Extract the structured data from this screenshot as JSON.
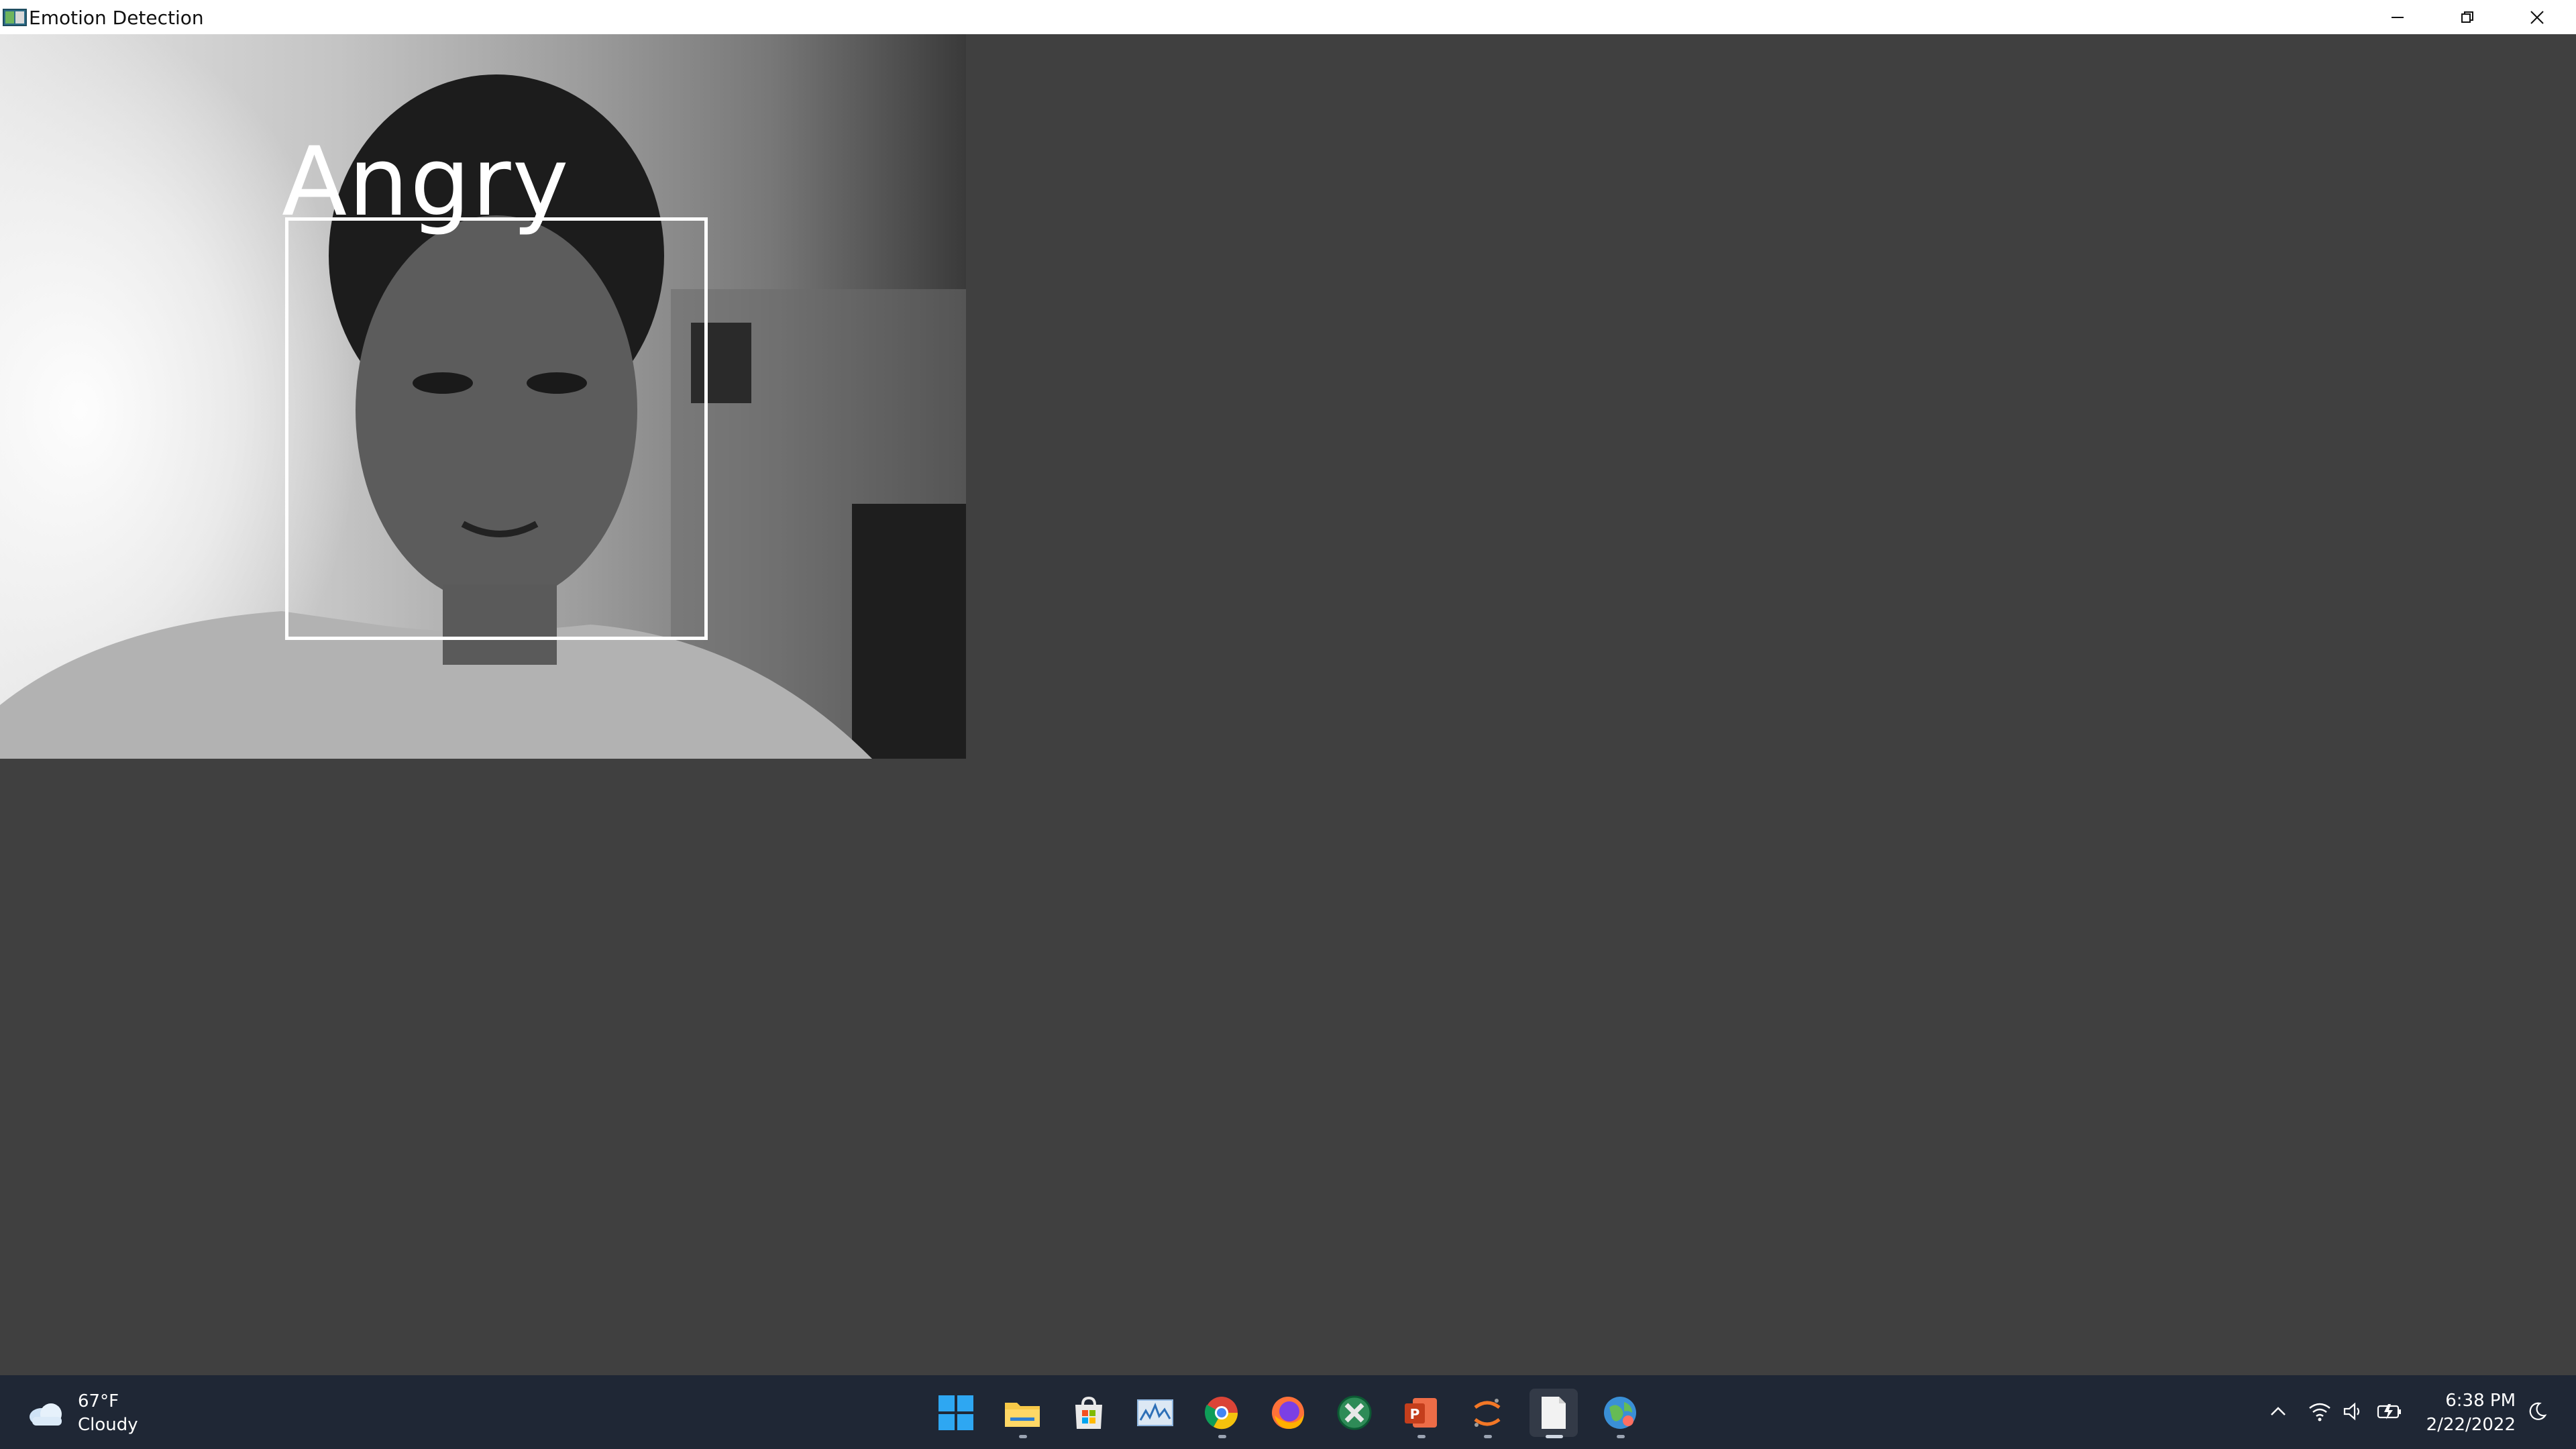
{
  "window": {
    "title": "Emotion Detection",
    "controls": {
      "minimize_icon": "minimize-icon",
      "maximize_icon": "restore-icon",
      "close_icon": "close-icon"
    }
  },
  "camera_view": {
    "detected_emotion": "Angry",
    "box_color": "#ffffff",
    "background": "#404040"
  },
  "taskbar": {
    "weather": {
      "temperature": "67°F",
      "condition": "Cloudy",
      "icon": "cloud-icon"
    },
    "apps": [
      {
        "name": "start",
        "icon": "windows-logo-icon"
      },
      {
        "name": "file-explorer",
        "icon": "folder-icon",
        "running": true
      },
      {
        "name": "microsoft-store",
        "icon": "store-icon"
      },
      {
        "name": "monitor-app",
        "icon": "chart-monitor-icon"
      },
      {
        "name": "chrome",
        "icon": "chrome-icon",
        "running": true
      },
      {
        "name": "firefox",
        "icon": "firefox-icon"
      },
      {
        "name": "app-green",
        "icon": "green-app-icon"
      },
      {
        "name": "powerpoint",
        "icon": "powerpoint-icon",
        "running": true
      },
      {
        "name": "jupyter",
        "icon": "jupyter-icon",
        "running": true
      },
      {
        "name": "document",
        "icon": "document-icon",
        "running": true,
        "active": true
      },
      {
        "name": "python-app",
        "icon": "globe-app-icon",
        "running": true
      }
    ],
    "tray": {
      "icons": [
        "chevron-up-icon",
        "wifi-icon",
        "speaker-icon",
        "battery-icon"
      ],
      "time": "6:38 PM",
      "date": "2/22/2022",
      "focus_icon": "moon-icon"
    }
  }
}
